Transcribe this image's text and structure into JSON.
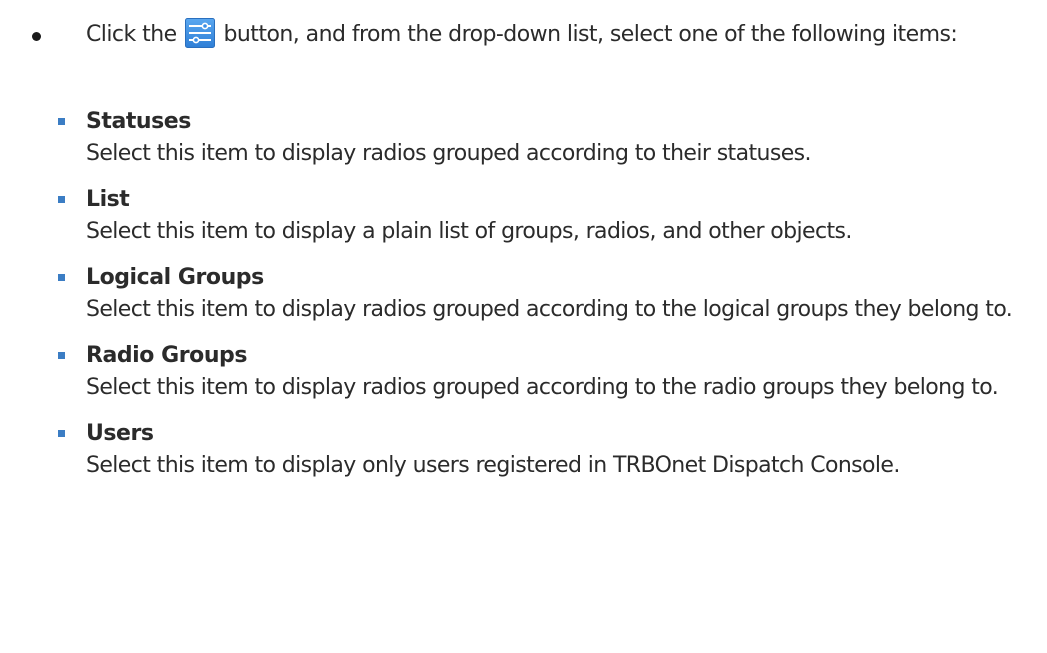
{
  "intro": {
    "before_icon": "Click the",
    "icon": "sliders-icon",
    "after_icon": "button, and from the drop-down list, select one of the following items:"
  },
  "options": [
    {
      "title": "Statuses",
      "description": "Select this item to display radios grouped according to their statuses."
    },
    {
      "title": "List",
      "description": "Select this item to display a plain list of groups, radios, and other objects."
    },
    {
      "title": "Logical Groups",
      "description": "Select this item to display radios grouped according to the logical groups they belong to."
    },
    {
      "title": "Radio Groups",
      "description": "Select this item to display radios grouped according to the radio groups they belong to."
    },
    {
      "title": "Users",
      "description": "Select this item to display only users registered in TRBOnet Dispatch Console."
    }
  ],
  "colors": {
    "text": "#2b2b2b",
    "sub_bullet": "#3b7dc4",
    "icon_bg": "#3a8ee6"
  }
}
